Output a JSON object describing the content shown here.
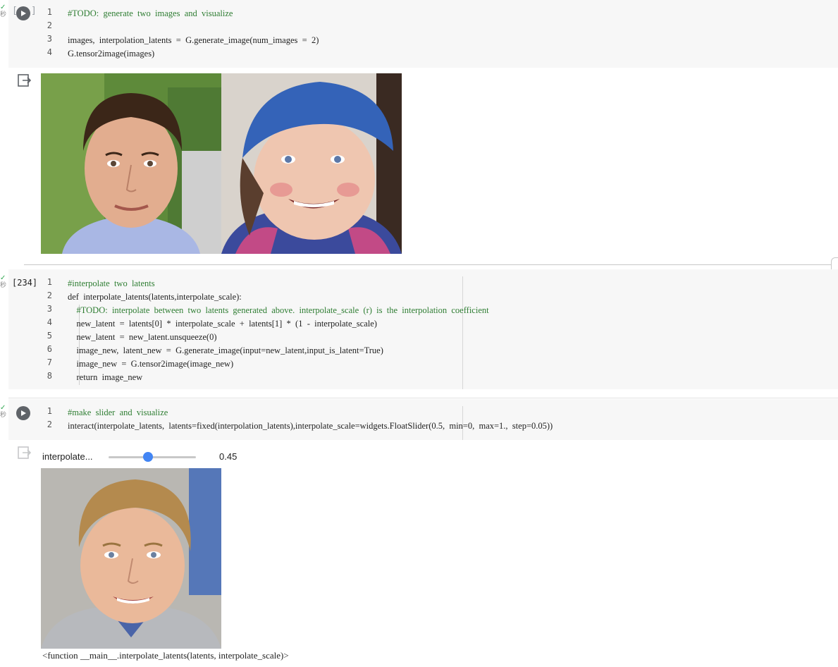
{
  "cells": [
    {
      "status_text": "秒",
      "lines": [
        {
          "n": "1",
          "text": "#TODO:  generate  two  images  and  visualize"
        },
        {
          "n": "2",
          "text": ""
        },
        {
          "n": "3",
          "text": "images,  interpolation_latents  =  G.generate_image(num_images  =  2)"
        },
        {
          "n": "4",
          "text": "G.tensor2image(images)"
        }
      ]
    },
    {
      "exec_count": "[234]",
      "status_text": "秒",
      "lines": [
        {
          "n": "1",
          "text": "#interpolate  two  latents"
        },
        {
          "n": "2",
          "text": "def  interpolate_latents(latents,interpolate_scale):"
        },
        {
          "n": "3",
          "text": "    #TODO:  interpolate  between  two  latents  generated  above.  interpolate_scale  (r)  is  the  interpolation  coefficient"
        },
        {
          "n": "4",
          "text": "    new_latent  =  latents[0]  *  interpolate_scale  +  latents[1]  *  (1  -  interpolate_scale)"
        },
        {
          "n": "5",
          "text": "    new_latent  =  new_latent.unsqueeze(0)"
        },
        {
          "n": "6",
          "text": "    image_new,  latent_new  =  G.generate_image(input=new_latent,input_is_latent=True)"
        },
        {
          "n": "7",
          "text": "    image_new  =  G.tensor2image(image_new)"
        },
        {
          "n": "8",
          "text": "    return  image_new"
        }
      ]
    },
    {
      "status_text": "秒",
      "lines": [
        {
          "n": "1",
          "text": "#make  slider  and  visualize"
        },
        {
          "n": "2",
          "text": "interact(interpolate_latents,  latents=fixed(interpolation_latents),interpolate_scale=widgets.FloatSlider(0.5,  min=0,  max=1.,  step=0.05))"
        }
      ]
    }
  ],
  "slider": {
    "label": "interpolate...",
    "value_text": "0.45",
    "min": 0,
    "max": 1,
    "value": 0.45
  },
  "output_repr": "<function __main__.interpolate_latents(latents, interpolate_scale)>",
  "colors": {
    "cell_bg": "#f7f7f7",
    "comment": "#2e7d32",
    "keyword": "#7b1fa2",
    "slider_thumb": "#4285f4",
    "run_button": "#5f6368"
  },
  "icons": [
    "run-icon",
    "output-toggle-icon",
    "check-icon"
  ]
}
